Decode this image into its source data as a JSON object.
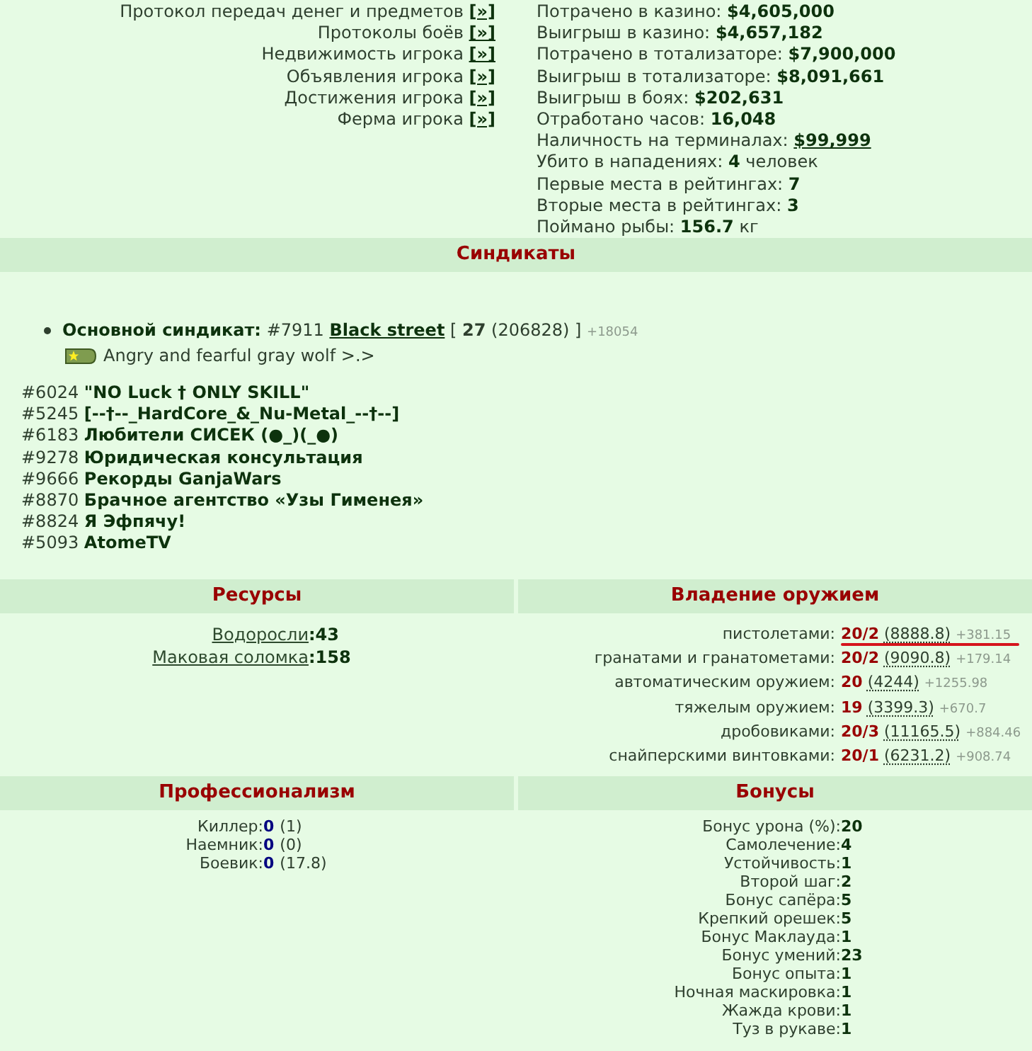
{
  "player_links": [
    {
      "label": "Протокол передач денег и предметов",
      "action": "[»]"
    },
    {
      "label": "Протоколы боёв",
      "action": "[»]"
    },
    {
      "label": "Недвижимость игрока",
      "action": "[»]"
    },
    {
      "label": "Объявления игрока",
      "action": "[»]"
    },
    {
      "label": "Достижения игрока",
      "action": "[»]"
    },
    {
      "label": "Ферма игрока",
      "action": "[»]"
    }
  ],
  "stats": [
    {
      "label": "Потрачено в казино:",
      "value": "$4,605,000",
      "link": false
    },
    {
      "label": "Выигрыш в казино:",
      "value": "$4,657,182",
      "link": false
    },
    {
      "label": "Потрачено в тотализаторе:",
      "value": "$7,900,000",
      "link": false
    },
    {
      "label": "Выигрыш в тотализаторе:",
      "value": "$8,091,661",
      "link": false
    },
    {
      "label": "Выигрыш в боях:",
      "value": "$202,631",
      "link": false
    },
    {
      "label": "Отработано часов:",
      "value": "16,048",
      "link": false
    },
    {
      "label": "Наличность на терминалах:",
      "value": "$99,999",
      "link": true
    },
    {
      "label": "Убито в нападениях:",
      "value": "4",
      "unit": "человек",
      "link": false
    },
    {
      "label": "Первые места в рейтингах:",
      "value": "7",
      "link": false
    },
    {
      "label": "Вторые места в рейтингах:",
      "value": "3",
      "link": false
    },
    {
      "label": "Поймано рыбы:",
      "value": "156.7",
      "unit": "кг",
      "link": false
    }
  ],
  "syndicates": {
    "title": "Синдикаты",
    "main": {
      "label": "Основной синдикат:",
      "number": "#7911",
      "name": "Black street",
      "info": "[ **27** (206828) ]",
      "delta": "+18054",
      "rank": "Angry and fearful gray wolf >.>"
    },
    "others": [
      {
        "number": "#6024",
        "name": "\"NO Luck † ONLY SKILL\""
      },
      {
        "number": "#5245",
        "name": "[--†--_HardCore_&_Nu-Metal_--†--]"
      },
      {
        "number": "#6183",
        "name": "Любители СИСЕК (●_)(_●)"
      },
      {
        "number": "#9278",
        "name": "Юридическая консультация"
      },
      {
        "number": "#9666",
        "name": "Рекорды GanjaWars"
      },
      {
        "number": "#8870",
        "name": "Брачное агентство «Узы Гименея»"
      },
      {
        "number": "#8824",
        "name": "Я Эфпячу!"
      },
      {
        "number": "#5093",
        "name": "AtomeTV"
      }
    ]
  },
  "resources": {
    "title": "Ресурсы",
    "items": [
      {
        "name": "Водоросли",
        "separator": ":",
        "value": "43"
      },
      {
        "name": "Маковая соломка",
        "separator": ":",
        "value": "158"
      }
    ]
  },
  "weapons": {
    "title": "Владение оружием",
    "items": [
      {
        "label": "пистолетами:",
        "rank": "20/2",
        "experience": "(8888.8)",
        "gain": "+381.15",
        "highlighted": true
      },
      {
        "label": "гранатами и гранатометами:",
        "rank": "20/2",
        "experience": "(9090.8)",
        "gain": "+179.14",
        "highlighted": false
      },
      {
        "label": "автоматическим оружием:",
        "rank": "20",
        "experience": "(4244)",
        "gain": "+1255.98",
        "highlighted": false
      },
      {
        "label": "тяжелым оружием:",
        "rank": "19",
        "experience": "(3399.3)",
        "gain": "+670.7",
        "highlighted": false
      },
      {
        "label": "дробовиками:",
        "rank": "20/3",
        "experience": "(11165.5)",
        "gain": "+884.46",
        "highlighted": false
      },
      {
        "label": "снайперскими винтовками:",
        "rank": "20/1",
        "experience": "(6231.2)",
        "gain": "+908.74",
        "highlighted": false
      }
    ]
  },
  "professionalism": {
    "title": "Профессионализм",
    "items": [
      {
        "label": "Киллер:",
        "value": "0",
        "extra": "(1)"
      },
      {
        "label": "Наемник:",
        "value": "0",
        "extra": "(0)"
      },
      {
        "label": "Боевик:",
        "value": "0",
        "extra": "(17.8)"
      }
    ]
  },
  "bonuses": {
    "title": "Бонусы",
    "items": [
      {
        "label": "Бонус урона (%):",
        "value": "20"
      },
      {
        "label": "Самолечение:",
        "value": "4"
      },
      {
        "label": "Устойчивость:",
        "value": "1"
      },
      {
        "label": "Второй шаг:",
        "value": "2"
      },
      {
        "label": "Бонус сапёра:",
        "value": "5"
      },
      {
        "label": "Крепкий орешек:",
        "value": "5"
      },
      {
        "label": "Бонус Маклауда:",
        "value": "1"
      },
      {
        "label": "Бонус умений:",
        "value": "23"
      },
      {
        "label": "Бонус опыта:",
        "value": "1"
      },
      {
        "label": "Ночная маскировка:",
        "value": "1"
      },
      {
        "label": "Жажда крови:",
        "value": "1"
      },
      {
        "label": "Туз в рукаве:",
        "value": "1"
      }
    ]
  }
}
